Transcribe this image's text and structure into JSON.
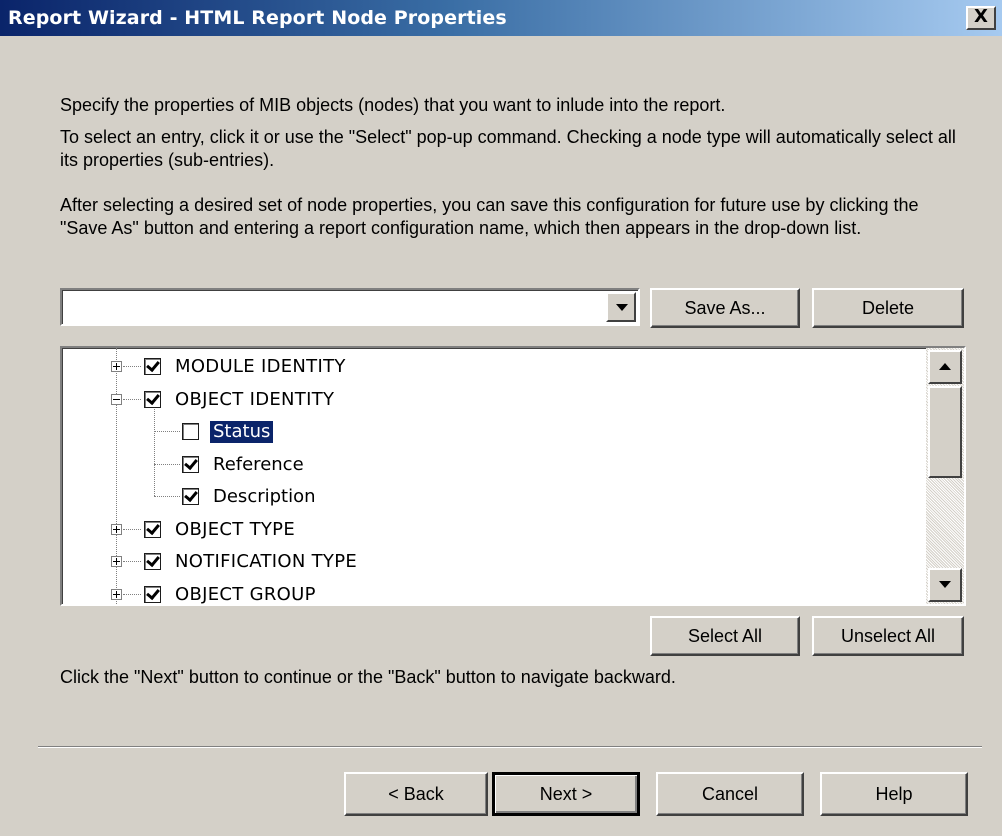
{
  "window": {
    "title": "Report Wizard - HTML Report Node Properties",
    "close_label": "X"
  },
  "instructions": {
    "line1": "Specify the properties of MIB objects (nodes) that you want to inlude into the report.",
    "line2": "To select an entry, click it or use the \"Select\" pop-up command. Checking a node type will automatically select all its properties (sub-entries).",
    "line3": "After selecting a desired set of node properties, you can save this configuration for future use by clicking the \"Save As\" button and entering a report configuration name, which then appears in the drop-down list."
  },
  "config_select": {
    "value": ""
  },
  "buttons": {
    "save_as": "Save As...",
    "delete": "Delete",
    "select_all": "Select All",
    "unselect_all": "Unselect All",
    "back": "< Back",
    "next": "Next >",
    "cancel": "Cancel",
    "help": "Help"
  },
  "tree": {
    "items": [
      {
        "label": "MODULE IDENTITY",
        "checked": true,
        "expander": "plus"
      },
      {
        "label": "OBJECT IDENTITY",
        "checked": true,
        "expander": "minus"
      },
      {
        "label": "Status",
        "checked": false,
        "selected": true
      },
      {
        "label": "Reference",
        "checked": true
      },
      {
        "label": "Description",
        "checked": true
      },
      {
        "label": "OBJECT TYPE",
        "checked": true,
        "expander": "plus"
      },
      {
        "label": "NOTIFICATION TYPE",
        "checked": true,
        "expander": "plus"
      },
      {
        "label": "OBJECT GROUP",
        "checked": true,
        "expander": "plus"
      }
    ]
  },
  "footer_hint": "Click the \"Next\" button to continue or the \"Back\" button to navigate backward.",
  "colors": {
    "dialog_bg": "#d4d0c8",
    "title_start": "#0a246a",
    "title_end": "#a6caf0",
    "selection": "#0a246a"
  }
}
